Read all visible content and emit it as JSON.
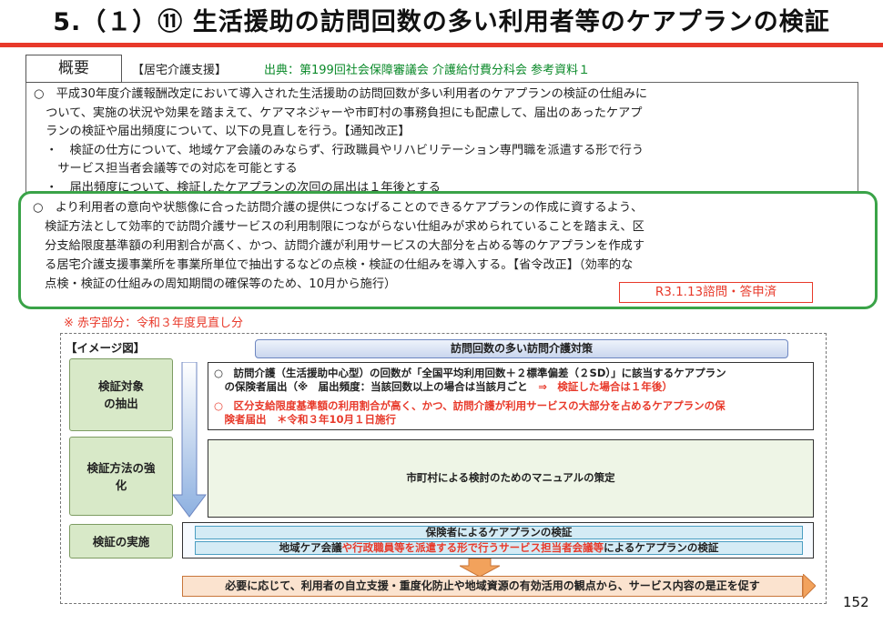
{
  "title": "5.（１）⑪  生活援助の訪問回数の多い利用者等のケアプランの検証",
  "overview": {
    "tab_label": "概要",
    "service_tag": "【居宅介護支援】",
    "source": "出典：第199回社会保障審議会 介護給付費分科会 参考資料１",
    "lines": [
      "○　平成30年度介護報酬改定において導入された生活援助の訪問回数が多い利用者のケアプランの検証の仕組みに",
      "　ついて、実施の状況や効果を踏まえて、ケアマネジャーや市町村の事務負担にも配慮して、届出のあったケアプ",
      "　ランの検証や届出頻度について、以下の見直しを行う。【通知改正】",
      "　・　検証の仕方について、地域ケア会議のみならず、行政職員やリハビリテーション専門職を派遣する形で行う",
      "　　サービス担当者会議等での対応を可能とする",
      "　・　届出頻度について、検証したケアプランの次回の届出は１年後とする"
    ],
    "highlight_lines": [
      "○　より利用者の意向や状態像に合った訪問介護の提供につなげることのできるケアプランの作成に資するよう、",
      "　検証方法として効率的で訪問介護サービスの利用制限につながらない仕組みが求められていることを踏まえ、区",
      "　分支給限度基準額の利用割合が高く、かつ、訪問介護が利用サービスの大部分を占める等のケアプランを作成す",
      "　る居宅介護支援事業所を事業所単位で抽出するなどの点検・検証の仕組みを導入する。【省令改正】（効率的な",
      "　点検・検証の仕組みの周知期間の確保等のため、10月から施行）"
    ],
    "revision_badge": "R3.1.13諮問・答申済",
    "red_note": "※ 赤字部分：令和３年度見直し分"
  },
  "image": {
    "label": "【イメージ図】",
    "banner": "訪問回数の多い訪問介護対策",
    "stages": [
      "検証対象\nの抽出",
      "検証方法の強\n化",
      "検証の実施"
    ],
    "panel1": {
      "a_line1": "○　訪問介護（生活援助中心型）の回数が「全国平均利用回数＋２標準偏差（２SD）」に該当するケアプラン",
      "a_line2_main": "　の保険者届出（※　届出頻度：当該回数以上の場合は当該月ごと　",
      "a_line2_red": "⇒　検証した場合は１年後）",
      "b_line1": "○　区分支給限度基準額の利用割合が高く、かつ、訪問介護が利用サービスの大部分を占めるケアプランの保",
      "b_line2": "　険者届出　＊令和３年10月１日施行"
    },
    "panel2": "市町村による検討のためのマニュアルの策定",
    "panel3": {
      "row1": "保険者によるケアプランの検証",
      "row2_a": "地域ケア会議",
      "row2_b": "や行政職員等を派遣する形で行うサービス担当者会議等",
      "row2_c": "によるケアプランの検証"
    },
    "bottom_bar": "必要に応じて、利用者の自立支援・重度化防止や地域資源の有効活用の観点から、サービス内容の是正を促す"
  },
  "page_number": "152",
  "colors": {
    "accent_red": "#e8392a",
    "green_frame": "#3aa348",
    "source_green": "#0b8a2a"
  }
}
